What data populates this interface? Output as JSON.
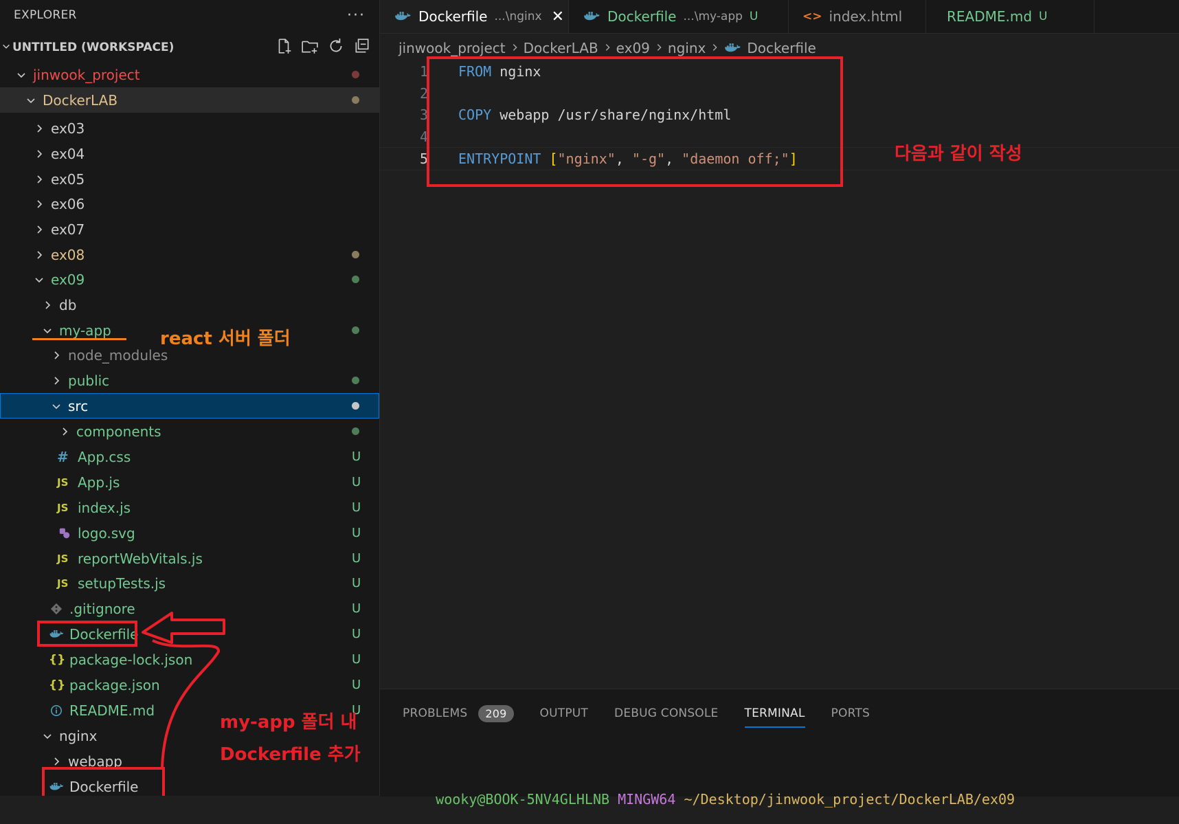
{
  "sidebar": {
    "header_title": "EXPLORER",
    "more_label": "···",
    "workspace_title": "UNTITLED (WORKSPACE)",
    "tree": [
      {
        "label": "jinwook_project",
        "kind": "folder",
        "open": true,
        "depth": 0,
        "color": "#f14c4c",
        "decoration": "dot"
      },
      {
        "label": "DockerLAB",
        "kind": "folder",
        "open": true,
        "depth": 1,
        "color": "#e2c08d",
        "decoration": "dot"
      },
      {
        "label": "ex03",
        "kind": "folder",
        "open": false,
        "depth": 2,
        "color": "#cccccc",
        "decoration": ""
      },
      {
        "label": "ex04",
        "kind": "folder",
        "open": false,
        "depth": 2,
        "color": "#cccccc",
        "decoration": ""
      },
      {
        "label": "ex05",
        "kind": "folder",
        "open": false,
        "depth": 2,
        "color": "#cccccc",
        "decoration": ""
      },
      {
        "label": "ex06",
        "kind": "folder",
        "open": false,
        "depth": 2,
        "color": "#cccccc",
        "decoration": ""
      },
      {
        "label": "ex07",
        "kind": "folder",
        "open": false,
        "depth": 2,
        "color": "#cccccc",
        "decoration": ""
      },
      {
        "label": "ex08",
        "kind": "folder",
        "open": false,
        "depth": 2,
        "color": "#e2c08d",
        "decoration": "dot"
      },
      {
        "label": "ex09",
        "kind": "folder",
        "open": true,
        "depth": 2,
        "color": "#73c991",
        "decoration": "dot"
      },
      {
        "label": "db",
        "kind": "folder",
        "open": false,
        "depth": 3,
        "color": "#cccccc",
        "decoration": ""
      },
      {
        "label": "my-app",
        "kind": "folder",
        "open": true,
        "depth": 3,
        "color": "#73c991",
        "decoration": "dot"
      },
      {
        "label": "node_modules",
        "kind": "folder",
        "open": false,
        "depth": 4,
        "color": "#8c8c8c",
        "decoration": ""
      },
      {
        "label": "public",
        "kind": "folder",
        "open": false,
        "depth": 4,
        "color": "#73c991",
        "decoration": "dot"
      },
      {
        "label": "src",
        "kind": "folder",
        "open": true,
        "depth": 4,
        "color": "#ffffff",
        "decoration": "dot",
        "selected": true
      },
      {
        "label": "components",
        "kind": "folder",
        "open": false,
        "depth": 5,
        "color": "#73c991",
        "decoration": "dot"
      },
      {
        "label": "App.css",
        "kind": "file",
        "icon": "css",
        "depth": 5,
        "color": "#73c991",
        "decoration": "U"
      },
      {
        "label": "App.js",
        "kind": "file",
        "icon": "js",
        "depth": 5,
        "color": "#73c991",
        "decoration": "U"
      },
      {
        "label": "index.js",
        "kind": "file",
        "icon": "js",
        "depth": 5,
        "color": "#73c991",
        "decoration": "U"
      },
      {
        "label": "logo.svg",
        "kind": "file",
        "icon": "svg",
        "depth": 5,
        "color": "#73c991",
        "decoration": "U"
      },
      {
        "label": "reportWebVitals.js",
        "kind": "file",
        "icon": "js",
        "depth": 5,
        "color": "#73c991",
        "decoration": "U"
      },
      {
        "label": "setupTests.js",
        "kind": "file",
        "icon": "js",
        "depth": 5,
        "color": "#73c991",
        "decoration": "U"
      },
      {
        "label": ".gitignore",
        "kind": "file",
        "icon": "git",
        "depth": 4,
        "color": "#73c991",
        "decoration": "U"
      },
      {
        "label": "Dockerfile",
        "kind": "file",
        "icon": "docker",
        "depth": 4,
        "color": "#73c991",
        "decoration": "U"
      },
      {
        "label": "package-lock.json",
        "kind": "file",
        "icon": "json",
        "depth": 4,
        "color": "#73c991",
        "decoration": "U"
      },
      {
        "label": "package.json",
        "kind": "file",
        "icon": "json",
        "depth": 4,
        "color": "#73c991",
        "decoration": "U"
      },
      {
        "label": "README.md",
        "kind": "file",
        "icon": "info",
        "depth": 4,
        "color": "#73c991",
        "decoration": "U"
      },
      {
        "label": "nginx",
        "kind": "folder",
        "open": true,
        "depth": 3,
        "color": "#cccccc",
        "decoration": ""
      },
      {
        "label": "webapp",
        "kind": "folder",
        "open": false,
        "depth": 4,
        "color": "#cccccc",
        "decoration": ""
      },
      {
        "label": "Dockerfile",
        "kind": "file",
        "icon": "docker",
        "depth": 4,
        "color": "#cccccc",
        "decoration": ""
      }
    ]
  },
  "tabs": [
    {
      "name": "Dockerfile",
      "desc": "...\\nginx",
      "badge": "",
      "active": true,
      "icon": "docker",
      "color": "#ffffff",
      "close": "✕"
    },
    {
      "name": "Dockerfile",
      "desc": "...\\my-app",
      "badge": "U",
      "active": false,
      "icon": "docker",
      "color": "#73c991"
    },
    {
      "name": "index.html",
      "desc": "",
      "badge": "",
      "active": false,
      "icon": "html",
      "color": "#9d9d9d"
    },
    {
      "name": "README.md",
      "desc": "",
      "badge": "U",
      "active": false,
      "icon": "info",
      "color": "#73c991"
    }
  ],
  "breadcrumb": [
    "jinwook_project",
    "DockerLAB",
    "ex09",
    "nginx",
    "Dockerfile"
  ],
  "editor": {
    "current_line": 5,
    "lines": [
      {
        "n": "1",
        "tokens": [
          [
            "kw",
            "FROM"
          ],
          [
            "plain",
            " nginx"
          ]
        ]
      },
      {
        "n": "2",
        "tokens": []
      },
      {
        "n": "3",
        "tokens": [
          [
            "kw",
            "COPY"
          ],
          [
            "plain",
            " webapp /usr/share/nginx/html"
          ]
        ]
      },
      {
        "n": "4",
        "tokens": []
      },
      {
        "n": "5",
        "tokens": [
          [
            "kw",
            "ENTRYPOINT"
          ],
          [
            "plain",
            " "
          ],
          [
            "brk",
            "["
          ],
          [
            "str",
            "\"nginx\""
          ],
          [
            "plain",
            ", "
          ],
          [
            "str",
            "\"-g\""
          ],
          [
            "plain",
            ", "
          ],
          [
            "str",
            "\"daemon off;\""
          ],
          [
            "brk",
            "]"
          ]
        ]
      }
    ]
  },
  "annotations": {
    "editor_note": "다음과 같이 작성",
    "react_note": "react 서버 폴더",
    "dockerfile_note_1": "my-app 폴더 내",
    "dockerfile_note_2": "Dockerfile 추가"
  },
  "panel": {
    "tabs": [
      "PROBLEMS",
      "OUTPUT",
      "DEBUG CONSOLE",
      "TERMINAL",
      "PORTS"
    ],
    "active_tab": "TERMINAL",
    "problems_count": "209",
    "terminal": {
      "user": "wooky@BOOK-5NV4GLHLNB",
      "system": "MINGW64",
      "path": "~/Desktop/jinwook_project/DockerLAB/ex09"
    }
  }
}
